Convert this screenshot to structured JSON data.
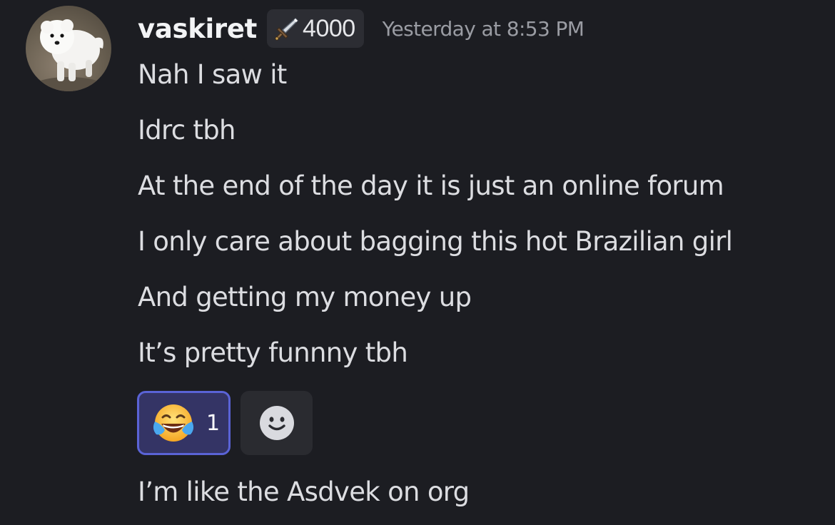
{
  "message": {
    "author": "vaskiret",
    "badge_count": "4000",
    "badge_icon": "sword-icon",
    "timestamp": "Yesterday at 8:53 PM",
    "lines": [
      "Nah I saw it",
      "Idrc tbh",
      "At the end of the day it is just an online forum",
      "I only care about bagging this hot Brazilian girl",
      "And getting my money up",
      "It’s pretty funnny tbh"
    ],
    "reactions": [
      {
        "emoji": "joy-emoji",
        "count": "1",
        "reacted": true
      }
    ],
    "add_reaction_icon": "add-reaction-smiley-icon",
    "after_reactions": "I’m like the Asdvek on org"
  },
  "colors": {
    "background": "#1c1d22",
    "reaction_border": "#5a63d6",
    "reaction_bg": "#343465"
  }
}
